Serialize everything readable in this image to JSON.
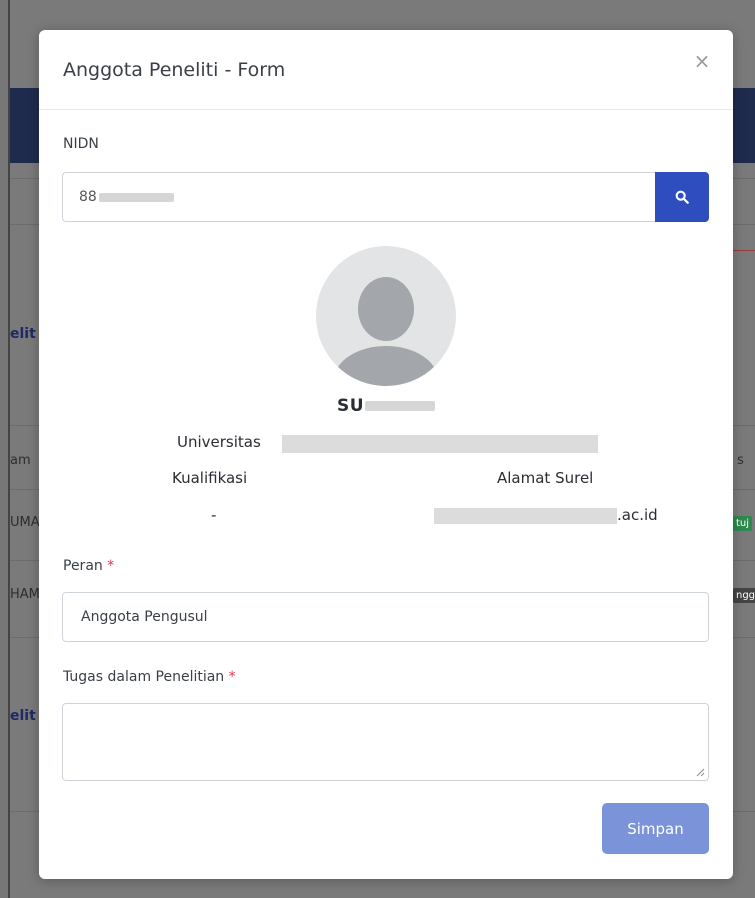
{
  "background": {
    "side_texts": [
      {
        "id": "bg-text-1",
        "text": "elit"
      },
      {
        "id": "bg-text-2",
        "text": "am"
      },
      {
        "id": "bg-text-3",
        "text": "UMA"
      },
      {
        "id": "bg-text-4",
        "text": "HAM"
      },
      {
        "id": "bg-text-5",
        "text": "elit"
      },
      {
        "id": "bg-text-6",
        "text": "s"
      },
      {
        "id": "bg-text-7",
        "text": "tuj"
      },
      {
        "id": "bg-text-8",
        "text": "ngg"
      }
    ]
  },
  "modal": {
    "title": "Anggota Peneliti - Form",
    "close_symbol": "×",
    "nidn": {
      "label": "NIDN",
      "value_prefix": "88",
      "search_icon": "search-icon"
    },
    "profile": {
      "avatar_icon": "user-avatar-icon",
      "name_prefix": "SU",
      "university_label": "Universitas",
      "qualification_label": "Kualifikasi",
      "qualification_value": "-",
      "email_label": "Alamat Surel",
      "email_suffix": ".ac.id"
    },
    "role": {
      "label": "Peran",
      "required_mark": "*",
      "selected_value": "Anggota Pengusul"
    },
    "task": {
      "label": "Tugas dalam Penelitian",
      "required_mark": "*",
      "value": ""
    },
    "save_label": "Simpan"
  },
  "colors": {
    "primary": "#2e4dbf",
    "save_button": "#7b93d8",
    "required": "#e0334f"
  }
}
